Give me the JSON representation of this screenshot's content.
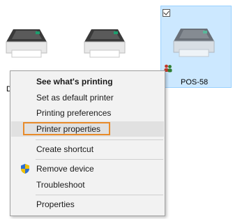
{
  "printers": [
    {
      "label": "D"
    },
    {
      "label": ""
    },
    {
      "label": "POS-58",
      "selected": true
    }
  ],
  "context_menu": {
    "items": [
      {
        "label": "See what's printing",
        "bold": true
      },
      {
        "label": "Set as default printer"
      },
      {
        "label": "Printing preferences"
      },
      {
        "label": "Printer properties",
        "highlighted": true
      },
      {
        "label": "Create shortcut"
      },
      {
        "label": "Remove device",
        "icon": "shield-icon"
      },
      {
        "label": "Troubleshoot"
      },
      {
        "label": "Properties"
      }
    ]
  },
  "colors": {
    "selection_bg": "#cce8ff",
    "highlight_border": "#e88b2a",
    "menu_bg": "#f2f2f2"
  }
}
